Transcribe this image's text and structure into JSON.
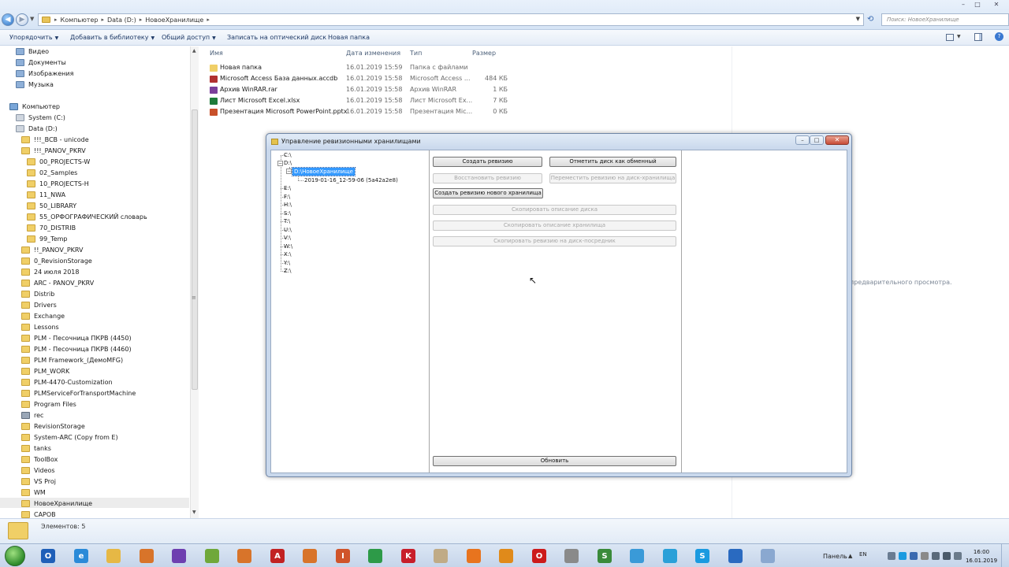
{
  "explorer": {
    "breadcrumb": [
      "Компьютер",
      "Data (D:)",
      "НовоеХранилище"
    ],
    "search_placeholder": "Поиск: НовоеХранилище",
    "toolbar": {
      "organize": "Упорядочить",
      "add_library": "Добавить в библиотеку",
      "share": "Общий доступ",
      "burn": "Записать на оптический диск",
      "new_folder": "Новая папка"
    },
    "nav": {
      "libraries": [
        "Видео",
        "Документы",
        "Изображения",
        "Музыка"
      ],
      "computer": "Компьютер",
      "drive_c": "System (C:)",
      "drive_d": "Data (D:)",
      "bcb": "!!!_BCB - unicode",
      "panov": "!!!_PANOV_PKRV",
      "panov_children": [
        "00_PROJECTS-W",
        "02_Samples",
        "10_PROJECTS-H",
        "11_NWA",
        "50_LIBRARY",
        "55_ОРФОГРАФИЧЕСКИЙ словарь",
        "70_DISTRIB",
        "99_Temp"
      ],
      "folders": [
        "!!_PANOV_PKRV",
        "0_RevisionStorage",
        "24 июля 2018",
        "ARC - PANOV_PKRV",
        "Distrib",
        "Drivers",
        "Exchange",
        "Lessons",
        "PLM - Песочница ПКРВ (4450)",
        "PLM - Песочница ПКРВ (4460)",
        "PLM Framework_(ДемоMFG)",
        "PLM_WORK",
        "PLM-4470-Customization",
        "PLMServiceForTransportMachine",
        "Program Files"
      ],
      "rec": "rec",
      "folders2": [
        "RevisionStorage",
        "System-ARC (Copy from E)",
        "tanks",
        "ToolBox",
        "Videos",
        "VS Proj",
        "WM",
        "НовоеХранилище",
        "САРОВ"
      ]
    },
    "columns": {
      "name": "Имя",
      "date": "Дата изменения",
      "type": "Тип",
      "size": "Размер"
    },
    "files": [
      {
        "name": "Новая папка",
        "date": "16.01.2019 15:59",
        "type": "Папка с файлами",
        "size": "",
        "icon": "folder-icon",
        "color": "#f0cf67"
      },
      {
        "name": "Microsoft Access База данных.accdb",
        "date": "16.01.2019 15:58",
        "type": "Microsoft Access ...",
        "size": "484 КБ",
        "icon": "access-file-icon",
        "color": "#b03030"
      },
      {
        "name": "Архив WinRAR.rar",
        "date": "16.01.2019 15:58",
        "type": "Архив WinRAR",
        "size": "1 КБ",
        "icon": "winrar-file-icon",
        "color": "#7a3f9a"
      },
      {
        "name": "Лист Microsoft Excel.xlsx",
        "date": "16.01.2019 15:58",
        "type": "Лист Microsoft Ex...",
        "size": "7 КБ",
        "icon": "excel-file-icon",
        "color": "#1e7b3a"
      },
      {
        "name": "Презентация Microsoft PowerPoint.pptx",
        "date": "16.01.2019 15:58",
        "type": "Презентация Mic...",
        "size": "0 КБ",
        "icon": "powerpoint-file-icon",
        "color": "#c8502a"
      }
    ],
    "preview_text": "предварительного просмотра.",
    "details": "Элементов: 5"
  },
  "dialog": {
    "title": "Управление ревизионными хранилищами",
    "tree": {
      "drives": [
        "C:\\",
        "D:\\",
        "E:\\",
        "F:\\",
        "H:\\",
        "S:\\",
        "T:\\",
        "U:\\",
        "V:\\",
        "W:\\",
        "X:\\",
        "Y:\\",
        "Z:\\"
      ],
      "storage": "D:\\НовоеХранилище",
      "revision": "2019-01-16_12-59-06 (5a42a2e8)"
    },
    "buttons": {
      "create_revision": "Создать ревизию",
      "mark_exchange": "Отметить диск как обменный",
      "restore_revision": "Восстановить ревизию",
      "move_revision": "Переместить ревизию на диск-хранилища",
      "create_new_storage_revision": "Создать ревизию нового хранилища",
      "copy_disk_desc": "Скопировать описание диска",
      "copy_storage_desc": "Скопировать описание хранилища",
      "copy_revision_intermediary": "Скопировать ревизию на диск-посредник",
      "refresh": "Обновить"
    }
  },
  "taskbar": {
    "panel_label": "Панель",
    "lang": "EN",
    "time": "16:00",
    "date": "16.01.2019",
    "apps": [
      {
        "name": "outlook-icon",
        "color": "#1f5fb8",
        "glyph": "O"
      },
      {
        "name": "ie-icon",
        "color": "#2a8ad8",
        "glyph": "e"
      },
      {
        "name": "explorer-icon",
        "color": "#e6b845",
        "glyph": ""
      },
      {
        "name": "far-icon",
        "color": "#d8742a",
        "glyph": ""
      },
      {
        "name": "visual-studio-icon",
        "color": "#6e3fb0",
        "glyph": ""
      },
      {
        "name": "notepad-plus-icon",
        "color": "#6fa83a",
        "glyph": ""
      },
      {
        "name": "far2-icon",
        "color": "#d8742a",
        "glyph": ""
      },
      {
        "name": "acrobat-icon",
        "color": "#c22222",
        "glyph": "A"
      },
      {
        "name": "search-tool-icon",
        "color": "#d8742a",
        "glyph": ""
      },
      {
        "name": "powerpoint-icon",
        "color": "#d0542a",
        "glyph": "I"
      },
      {
        "name": "chrome-icon",
        "color": "#2d9a48",
        "glyph": ""
      },
      {
        "name": "kaspersky-icon",
        "color": "#c81e2a",
        "glyph": "K"
      },
      {
        "name": "photos-icon",
        "color": "#c0ab86",
        "glyph": ""
      },
      {
        "name": "firefox-icon",
        "color": "#e8741e",
        "glyph": ""
      },
      {
        "name": "hamachi-icon",
        "color": "#e08a1a",
        "glyph": ""
      },
      {
        "name": "opera-icon",
        "color": "#cc1a1a",
        "glyph": "O"
      },
      {
        "name": "tool-icon",
        "color": "#8a8a8a",
        "glyph": ""
      },
      {
        "name": "sheets-icon",
        "color": "#3a8a3a",
        "glyph": "S"
      },
      {
        "name": "telegram-ie-icon",
        "color": "#3a9ad8",
        "glyph": ""
      },
      {
        "name": "telegram-icon",
        "color": "#2aa0d8",
        "glyph": ""
      },
      {
        "name": "skype-icon",
        "color": "#1a9ae0",
        "glyph": "S"
      },
      {
        "name": "feather-icon",
        "color": "#2a6ac0",
        "glyph": ""
      },
      {
        "name": "window-app-icon",
        "color": "#8aa8d0",
        "glyph": ""
      }
    ]
  }
}
